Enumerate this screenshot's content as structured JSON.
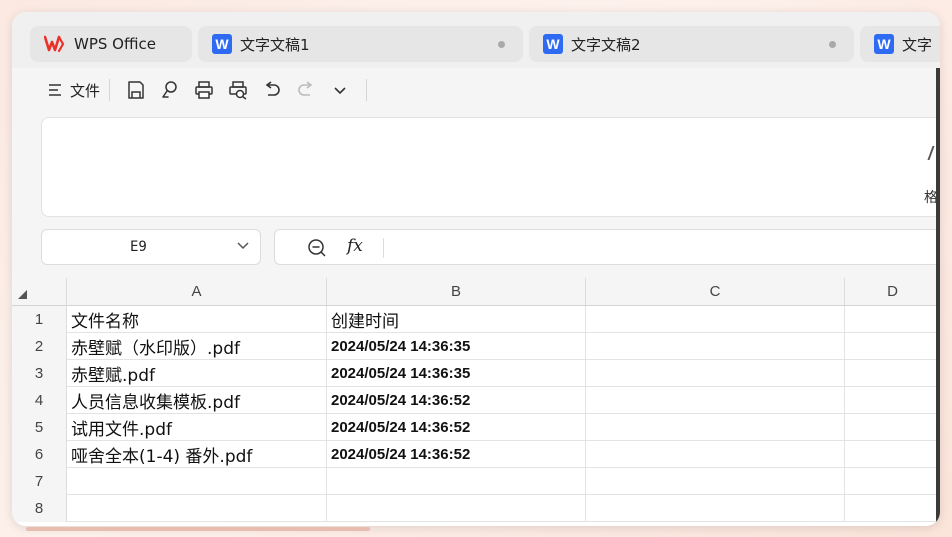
{
  "tabs": [
    {
      "label": "WPS Office",
      "icon": "wps-logo-icon",
      "active": false
    },
    {
      "label": "文字文稿1",
      "icon": "writer-w-icon"
    },
    {
      "label": "文字文稿2",
      "icon": "writer-w-icon"
    },
    {
      "label": "文字",
      "icon": "writer-w-icon"
    }
  ],
  "toolbar": {
    "menu_label": "文件",
    "icons": [
      "menu-icon",
      "save-icon",
      "save-as-icon",
      "print-icon",
      "print-preview-icon",
      "undo-icon",
      "redo-icon",
      "more-chevron-icon"
    ]
  },
  "ribbon": {
    "tail_text": "格"
  },
  "formula_bar": {
    "cell_ref": "E9",
    "fx_label": "fx",
    "formula": ""
  },
  "grid": {
    "columns": [
      "A",
      "B",
      "C",
      "D"
    ],
    "rows": [
      {
        "num": "1",
        "a": "文件名称",
        "b": "创建时间"
      },
      {
        "num": "2",
        "a": "赤壁赋（水印版）.pdf",
        "b": "2024/05/24 14:36:35"
      },
      {
        "num": "3",
        "a": "赤壁赋.pdf",
        "b": "2024/05/24 14:36:35"
      },
      {
        "num": "4",
        "a": "人员信息收集模板.pdf",
        "b": "2024/05/24 14:36:52"
      },
      {
        "num": "5",
        "a": "试用文件.pdf",
        "b": "2024/05/24 14:36:52"
      },
      {
        "num": "6",
        "a": "哑舍全本(1-4) 番外.pdf",
        "b": "2024/05/24 14:36:52"
      },
      {
        "num": "7",
        "a": "",
        "b": ""
      },
      {
        "num": "8",
        "a": "",
        "b": ""
      }
    ]
  },
  "colors": {
    "accent_blue": "#2f6bf2",
    "wps_red": "#e8322b"
  }
}
